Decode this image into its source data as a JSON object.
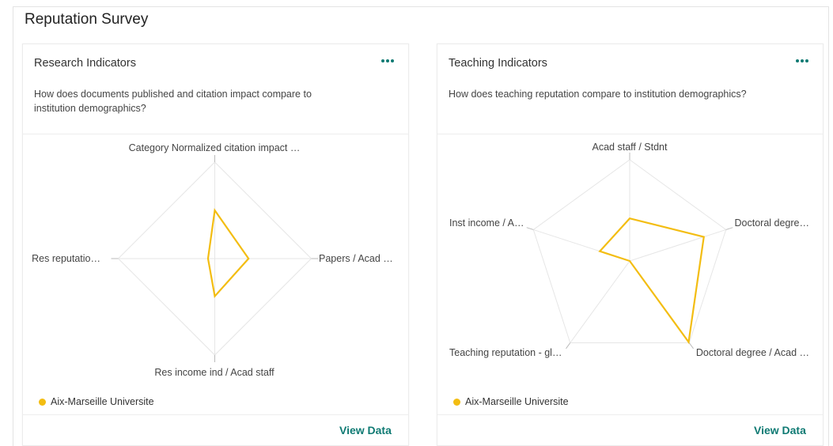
{
  "section": {
    "title": "Reputation Survey"
  },
  "colors": {
    "accent": "#0f7a73",
    "series": "#f3bd12",
    "grid": "#e6e6e6"
  },
  "cards": [
    {
      "title": "Research Indicators",
      "description_line1": "How does documents published and citation impact compare to",
      "description_line2": "institution demographics?",
      "more_icon": "more-horizontal-icon",
      "legend": "Aix-Marseille Universite",
      "view_data": "View Data",
      "chart_data": {
        "type": "radar",
        "axes": [
          "Category Normalized citation impact …",
          "Papers / Acad …",
          "Res income ind / Acad staff",
          "Res reputatio…"
        ],
        "series": [
          {
            "name": "Aix-Marseille Universite",
            "values": [
              0.5,
              0.35,
              0.39,
              0.07
            ]
          }
        ],
        "range": [
          0,
          1
        ],
        "grid": true,
        "legend": "bottom-left"
      }
    },
    {
      "title": "Teaching Indicators",
      "description_line1": "How does teaching reputation compare to institution demographics?",
      "description_line2": "",
      "more_icon": "more-horizontal-icon",
      "legend": "Aix-Marseille Universite",
      "view_data": "View Data",
      "chart_data": {
        "type": "radar",
        "axes": [
          "Acad staff / Stdnt",
          "Doctoral degre…",
          "Doctoral degree / Acad …",
          "Teaching reputation - gl…",
          "Inst income / A…"
        ],
        "series": [
          {
            "name": "Aix-Marseille Universite",
            "values": [
              0.42,
              0.77,
              0.99,
              0.0,
              0.31
            ]
          }
        ],
        "range": [
          0,
          1
        ],
        "grid": true,
        "legend": "bottom-left"
      }
    }
  ]
}
